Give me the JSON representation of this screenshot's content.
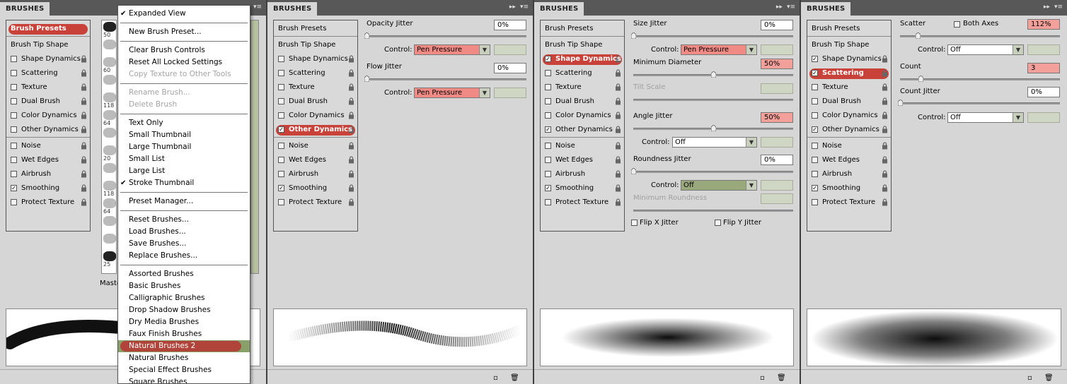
{
  "title": "BRUSHES",
  "colors": {
    "highlight": "#c9423a",
    "control_red": "#f08a84",
    "control_green": "#9aa97c",
    "hover_green": "#8aa06a"
  },
  "list_items": [
    "Brush Presets",
    "Brush Tip Shape",
    "Shape Dynamics",
    "Scattering",
    "Texture",
    "Dual Brush",
    "Color Dynamics",
    "Other Dynamics",
    "Noise",
    "Wet Edges",
    "Airbrush",
    "Smoothing",
    "Protect Texture"
  ],
  "panel1": {
    "checked": [
      false,
      false,
      false,
      false,
      false,
      false,
      false,
      false,
      false,
      false,
      false,
      true,
      false
    ],
    "thumb_sizes": [
      "50",
      "",
      "60",
      "",
      "118",
      "64",
      "",
      "20",
      "",
      "118",
      "64",
      "",
      "",
      "25"
    ],
    "master_label": "Maste"
  },
  "menu": {
    "items": [
      {
        "label": "Expanded View",
        "checked": true
      },
      {
        "sep": true
      },
      {
        "label": "New Brush Preset..."
      },
      {
        "sep": true
      },
      {
        "label": "Clear Brush Controls"
      },
      {
        "label": "Reset All Locked Settings"
      },
      {
        "label": "Copy Texture to Other Tools",
        "disabled": true
      },
      {
        "sep": true
      },
      {
        "label": "Rename Brush...",
        "disabled": true
      },
      {
        "label": "Delete Brush",
        "disabled": true
      },
      {
        "sep": true
      },
      {
        "label": "Text Only"
      },
      {
        "label": "Small Thumbnail"
      },
      {
        "label": "Large Thumbnail"
      },
      {
        "label": "Small List"
      },
      {
        "label": "Large List"
      },
      {
        "label": "Stroke Thumbnail",
        "checked": true
      },
      {
        "sep": true
      },
      {
        "label": "Preset Manager..."
      },
      {
        "sep": true
      },
      {
        "label": "Reset Brushes..."
      },
      {
        "label": "Load Brushes..."
      },
      {
        "label": "Save Brushes..."
      },
      {
        "label": "Replace Brushes..."
      },
      {
        "sep": true
      },
      {
        "label": "Assorted Brushes"
      },
      {
        "label": "Basic Brushes"
      },
      {
        "label": "Calligraphic Brushes"
      },
      {
        "label": "Drop Shadow Brushes"
      },
      {
        "label": "Dry Media Brushes"
      },
      {
        "label": "Faux Finish Brushes"
      },
      {
        "label": "Natural Brushes 2",
        "hover": true
      },
      {
        "label": "Natural Brushes"
      },
      {
        "label": "Special Effect Brushes"
      },
      {
        "label": "Square Brushes"
      }
    ]
  },
  "panel2": {
    "checked": [
      false,
      false,
      false,
      false,
      false,
      false,
      false,
      true,
      false,
      false,
      false,
      true,
      false
    ],
    "opacity_jitter_label": "Opacity Jitter",
    "opacity_jitter_value": "0%",
    "control_label": "Control:",
    "control1_value": "Pen Pressure",
    "flow_jitter_label": "Flow Jitter",
    "flow_jitter_value": "0%",
    "control2_value": "Pen Pressure"
  },
  "panel3": {
    "checked": [
      false,
      false,
      true,
      false,
      false,
      false,
      false,
      true,
      false,
      false,
      false,
      true,
      false
    ],
    "size_jitter_label": "Size Jitter",
    "size_jitter_value": "0%",
    "control_label": "Control:",
    "control1_value": "Pen Pressure",
    "min_diameter_label": "Minimum Diameter",
    "min_diameter_value": "50%",
    "tilt_scale_label": "Tilt Scale",
    "angle_jitter_label": "Angle Jitter",
    "angle_jitter_value": "50%",
    "control2_value": "Off",
    "roundness_jitter_label": "Roundness Jitter",
    "roundness_jitter_value": "0%",
    "control3_value": "Off",
    "min_roundness_label": "Minimum Roundness",
    "flip_x_label": "Flip X Jitter",
    "flip_y_label": "Flip Y Jitter",
    "slider_levels": {
      "size_jitter": 0,
      "min_diameter": 0.5,
      "angle_jitter": 0.5,
      "roundness_jitter": 0
    }
  },
  "panel4": {
    "checked": [
      false,
      false,
      true,
      true,
      false,
      false,
      false,
      true,
      false,
      false,
      false,
      true,
      false
    ],
    "scatter_label": "Scatter",
    "both_axes_label": "Both Axes",
    "scatter_value": "112%",
    "control_label": "Control:",
    "control1_value": "Off",
    "count_label": "Count",
    "count_value": "3",
    "count_jitter_label": "Count Jitter",
    "count_jitter_value": "0%",
    "control2_value": "Off"
  }
}
